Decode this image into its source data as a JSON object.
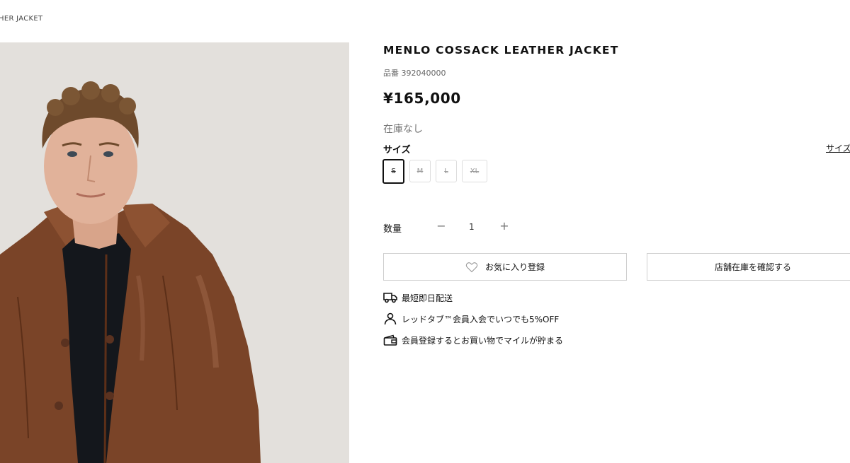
{
  "breadcrumb": {
    "current": "HER JACKET"
  },
  "product": {
    "title": "MENLO COSSACK LEATHER JACKET",
    "sku": "品番 392040000",
    "price": "¥165,000",
    "stock_status": "在庫なし"
  },
  "size": {
    "label": "サイズ",
    "guide_link": "サイズ",
    "options": [
      "S",
      "M",
      "L",
      "XL"
    ],
    "selected": "S"
  },
  "quantity": {
    "label": "数量",
    "minus": "−",
    "value": "1",
    "plus": "+"
  },
  "buttons": {
    "favorite": "お気に入り登録",
    "store_stock": "店舗在庫を確認する"
  },
  "features": [
    {
      "icon": "truck-icon",
      "text": "最短即日配送"
    },
    {
      "icon": "person-icon",
      "text": "レッドタブ™会員入会でいつでも5%OFF"
    },
    {
      "icon": "wallet-icon",
      "text": "会員登録するとお買い物でマイルが貯まる"
    }
  ]
}
